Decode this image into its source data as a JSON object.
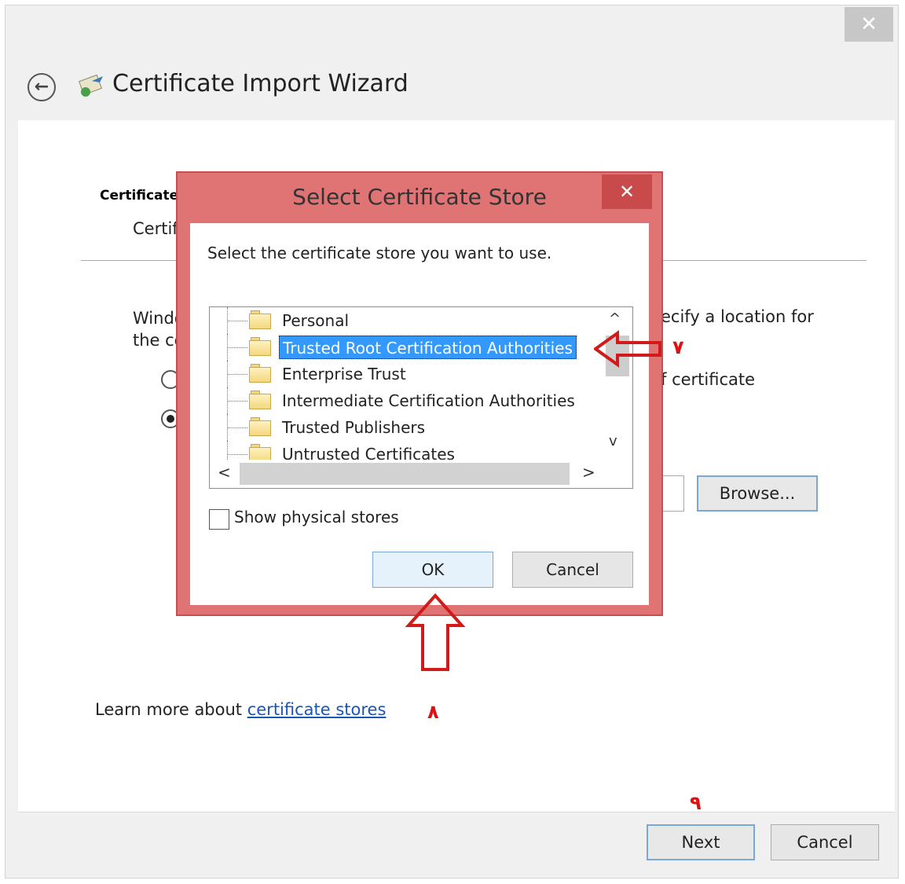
{
  "window": {
    "close_glyph": "✕",
    "back_glyph": "←",
    "title": "Certificate Import Wizard"
  },
  "page": {
    "heading": "Certificate",
    "subheading": "Certif",
    "desc_left_line1": "Windo",
    "desc_left_line2": "the ce",
    "desc_right": "ecify a location for",
    "option_right": "f certificate",
    "browse_label": "Browse...",
    "learn_prefix": "Learn more about ",
    "learn_link": "certificate stores"
  },
  "footer": {
    "next_label": "Next",
    "cancel_label": "Cancel"
  },
  "dialog": {
    "title": "Select Certificate Store",
    "close_glyph": "✕",
    "prompt": "Select the certificate store you want to use.",
    "stores": [
      {
        "label": "Personal",
        "selected": false
      },
      {
        "label": "Trusted Root Certification Authorities",
        "selected": true
      },
      {
        "label": "Enterprise Trust",
        "selected": false
      },
      {
        "label": "Intermediate Certification Authorities",
        "selected": false
      },
      {
        "label": "Trusted Publishers",
        "selected": false
      },
      {
        "label": "Untrusted Certificates",
        "selected": false
      }
    ],
    "scroll_up": "^",
    "scroll_down": "v",
    "scroll_left": "<",
    "scroll_right": ">",
    "show_physical_label": "Show physical stores",
    "ok_label": "OK",
    "cancel_label": "Cancel"
  },
  "annotations": {
    "step7": "۷",
    "step8": "۸",
    "step9": "۹",
    "arrow_color": "#d11a1a"
  }
}
